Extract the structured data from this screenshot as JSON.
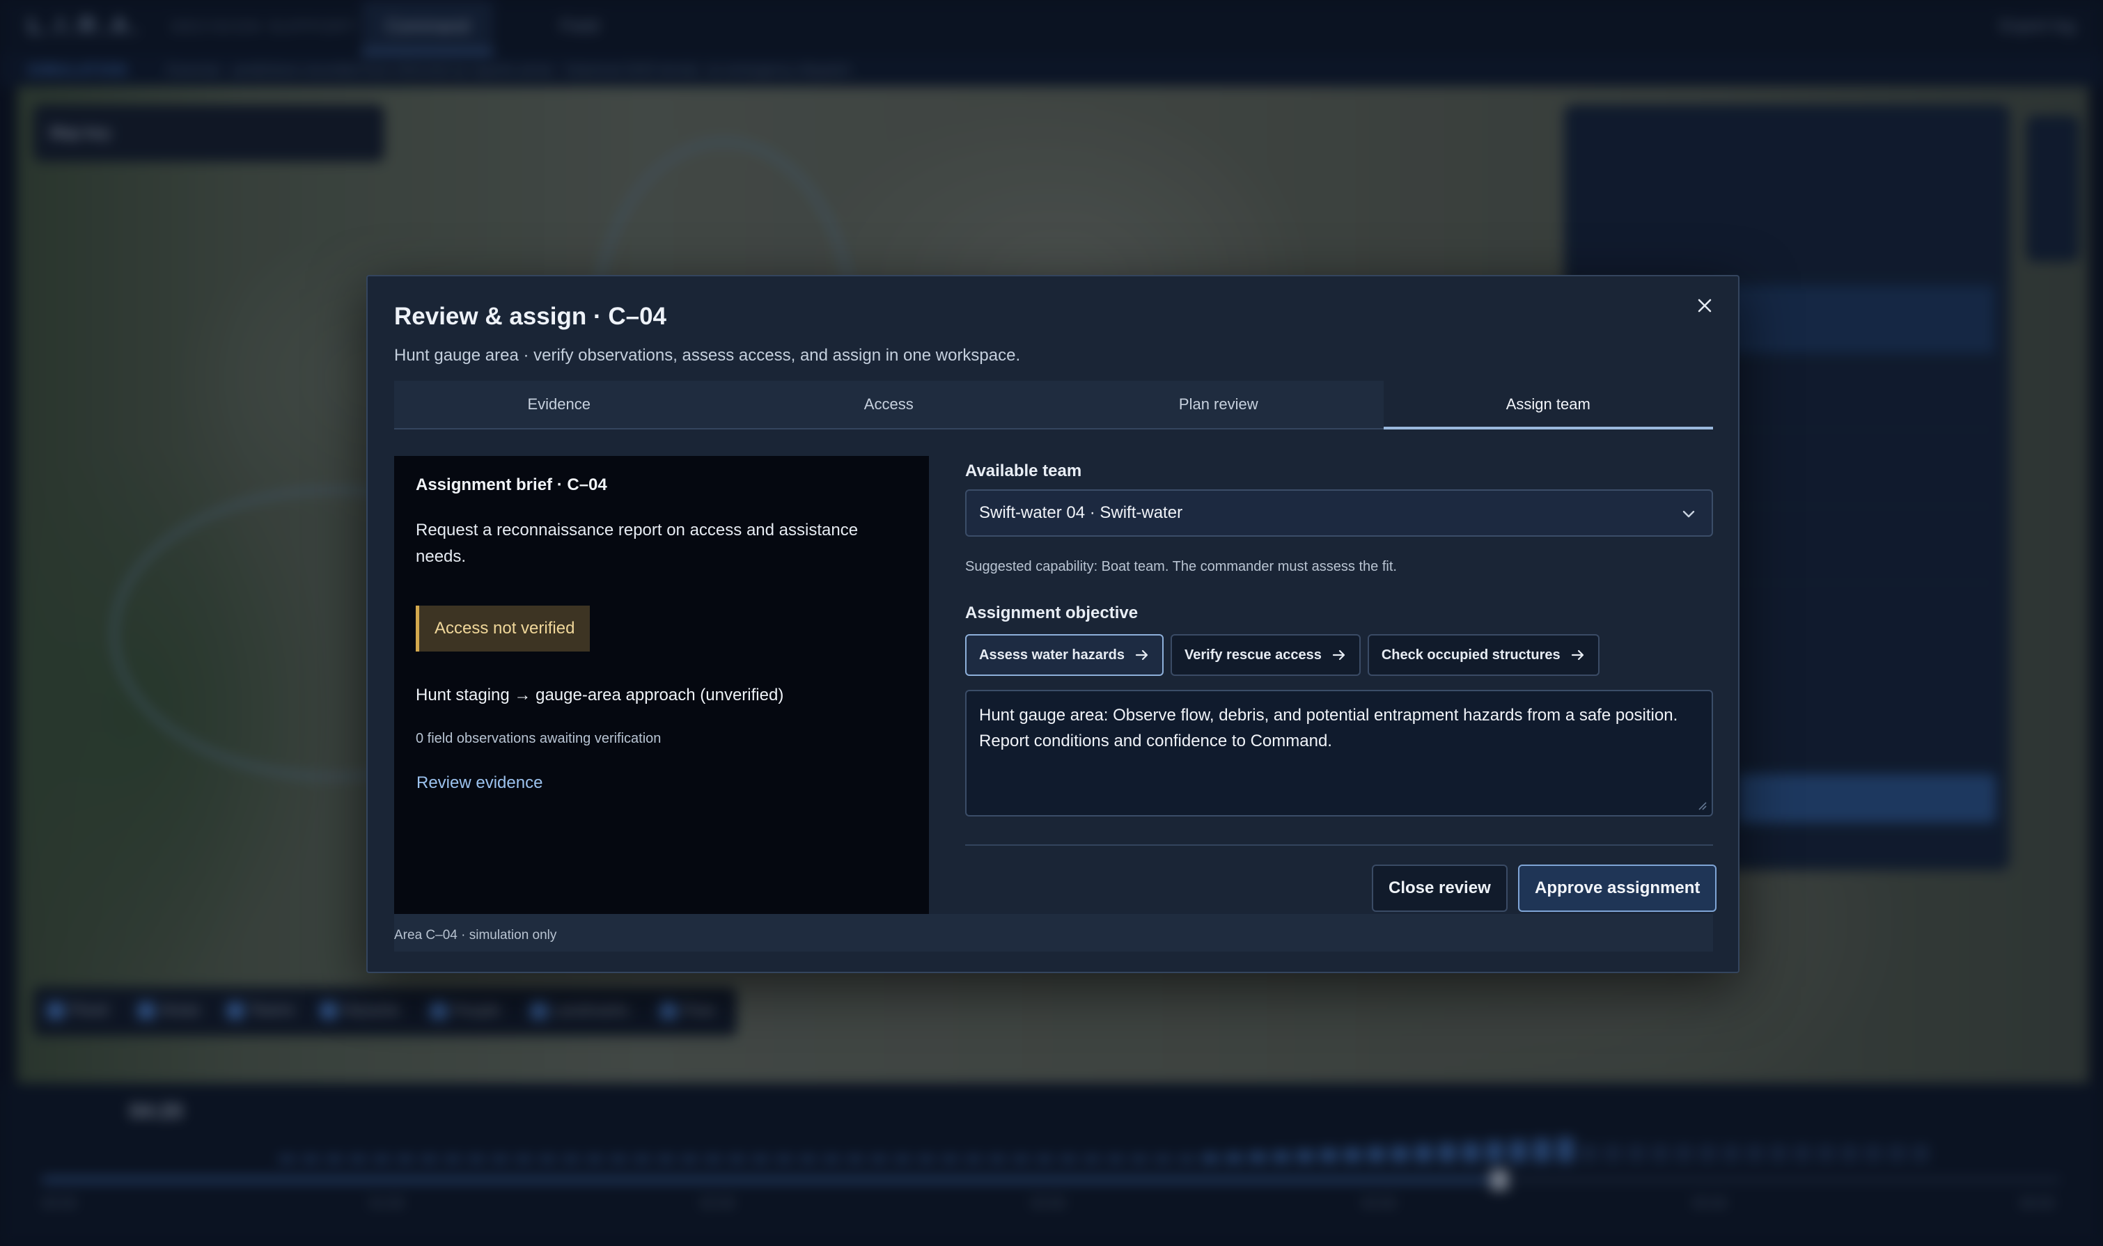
{
  "app": {
    "logo": "L.I.R.A.",
    "logo_sub": "DECISION SUPPORT",
    "tabs": [
      "Command",
      "Field"
    ],
    "export_label": "Export log",
    "sim_label": "SIMULATION",
    "sim_text": "Exercise · predictions recorded from informed as reports arrive · historical 2025 terrain, no emergency dispatch",
    "map_selector": "Map key",
    "layers": [
      "Flood",
      "Areas",
      "Teams",
      "Hazards",
      "People",
      "Landmarks",
      "Flow"
    ],
    "clock": "04:20",
    "timeline_ticks": [
      "00:00",
      "01:00",
      "02:00",
      "03:00",
      "04:00",
      "05:00",
      "06:00"
    ]
  },
  "modal": {
    "title": "Review & assign · C–04",
    "subtitle": "Hunt gauge area · verify observations, assess access, and assign in one workspace.",
    "tabs": [
      {
        "label": "Evidence"
      },
      {
        "label": "Access"
      },
      {
        "label": "Plan review"
      },
      {
        "label": "Assign team"
      }
    ],
    "active_tab": "Assign team",
    "brief": {
      "title": "Assignment brief · C–04",
      "request": "Request a reconnaissance report on access and assistance needs.",
      "badge": "Access not verified",
      "route": "Hunt staging → gauge-area approach (unverified)",
      "observations": "0 field observations awaiting verification",
      "review_link": "Review evidence"
    },
    "team": {
      "label": "Available team",
      "selected": "Swift-water 04 · Swift-water",
      "hint": "Suggested capability: Boat team. The commander must assess the fit."
    },
    "objective": {
      "label": "Assignment objective",
      "options": [
        "Assess water hazards",
        "Verify rescue access",
        "Check occupied structures"
      ],
      "selected": "Assess water hazards",
      "text": "Hunt gauge area: Observe flow, debris, and potential entrapment hazards from a safe position. Report conditions and confidence to Command."
    },
    "buttons": {
      "close": "Close review",
      "approve": "Approve assignment"
    },
    "footer": "Area C–04 · simulation only"
  }
}
